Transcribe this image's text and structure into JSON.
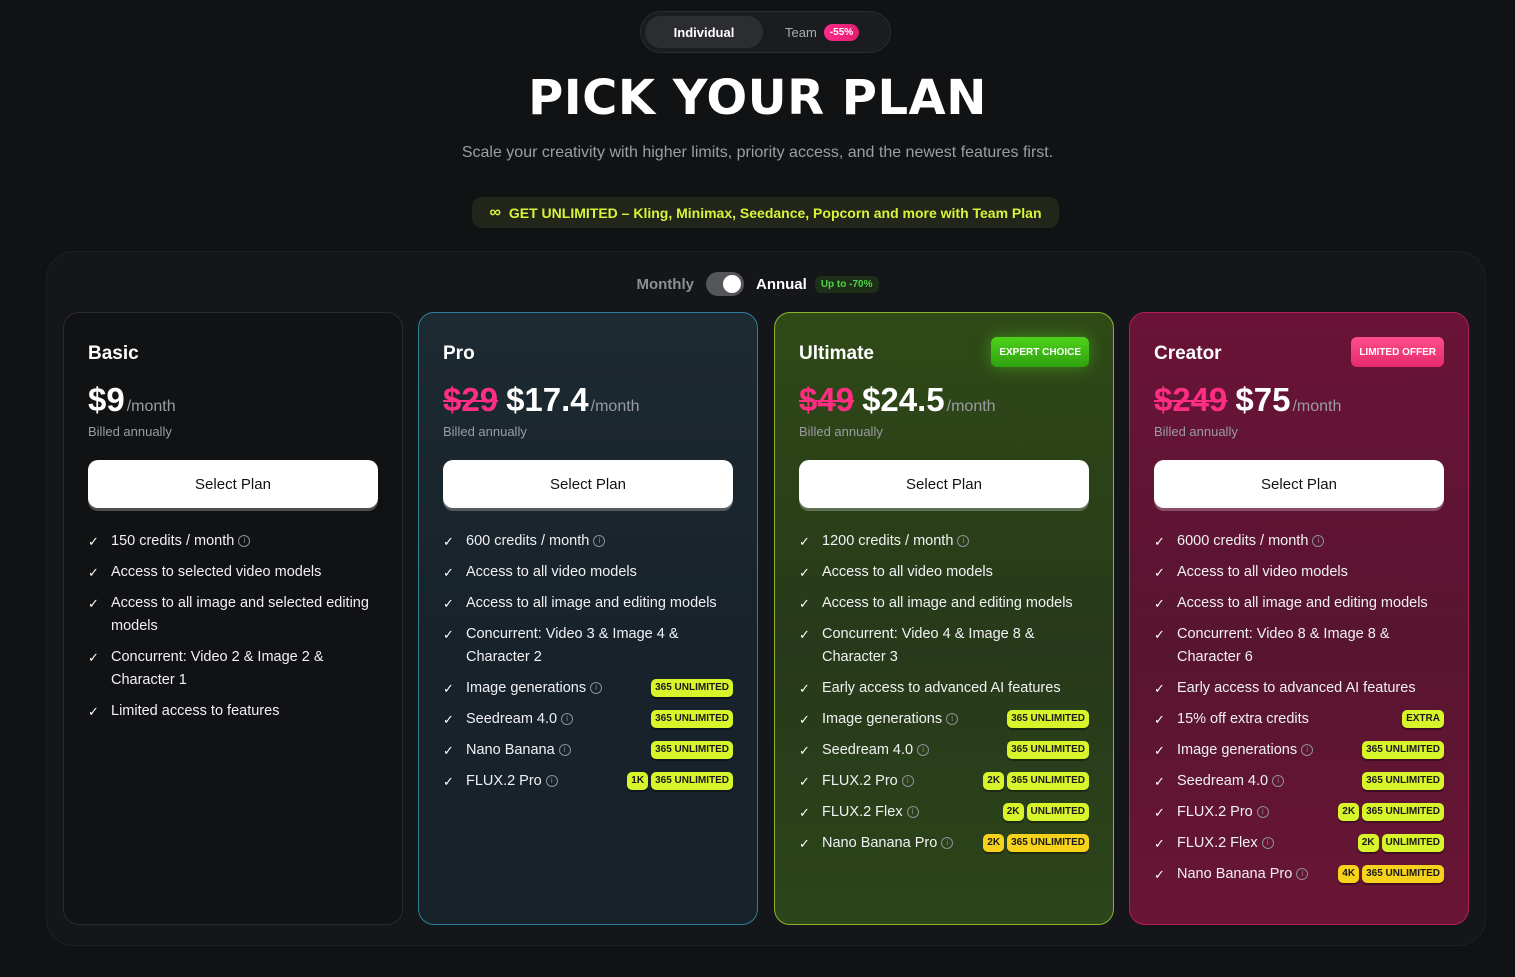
{
  "seg": {
    "individual": "Individual",
    "team": "Team",
    "team_badge": "-55%"
  },
  "title": "PICK YOUR PLAN",
  "subtitle": "Scale your creativity with higher limits, priority access, and the newest features first.",
  "promo": {
    "icon": "∞",
    "text": "GET UNLIMITED – Kling, Minimax, Seedance, Popcorn and more with Team Plan"
  },
  "billing": {
    "monthly": "Monthly",
    "annual": "Annual",
    "badge": "Up to -70%",
    "annual_selected": true
  },
  "colors": {
    "accent_lime": "#d7f52a",
    "accent_pink": "#ff2e83",
    "expert_green": "#3ec11a"
  },
  "cards": [
    {
      "name": "Basic",
      "price_old": "",
      "price": "$9",
      "per": "/month",
      "billed": "Billed annually",
      "button": "Select Plan",
      "features": [
        {
          "text": "150 credits / month",
          "info": true,
          "tags": []
        },
        {
          "text": "Access to selected video models",
          "info": false,
          "tags": []
        },
        {
          "text": "Access to all image and selected editing models",
          "info": false,
          "tags": []
        },
        {
          "text": "Concurrent: Video 2 & Image 2 & Character 1",
          "info": false,
          "tags": []
        },
        {
          "text": "Limited access to features",
          "info": false,
          "tags": []
        }
      ]
    },
    {
      "name": "Pro",
      "price_old": "$29",
      "price": "$17.4",
      "per": "/month",
      "billed": "Billed annually",
      "button": "Select Plan",
      "features": [
        {
          "text": "600 credits / month",
          "info": true,
          "tags": []
        },
        {
          "text": "Access to all video models",
          "info": false,
          "tags": []
        },
        {
          "text": "Access to all image and editing models",
          "info": false,
          "tags": []
        },
        {
          "text": "Concurrent: Video 3 & Image 4 & Character 2",
          "info": false,
          "tags": []
        },
        {
          "text": "Image generations",
          "info": true,
          "tags": [
            "365 UNLIMITED"
          ]
        },
        {
          "text": "Seedream 4.0",
          "info": true,
          "tags": [
            "365 UNLIMITED"
          ]
        },
        {
          "text": "Nano Banana",
          "info": true,
          "tags": [
            "365 UNLIMITED"
          ]
        },
        {
          "text": "FLUX.2 Pro",
          "info": true,
          "tags": [
            "1K",
            "365 UNLIMITED"
          ]
        }
      ]
    },
    {
      "name": "Ultimate",
      "ribbon": "EXPERT CHOICE",
      "price_old": "$49",
      "price": "$24.5",
      "per": "/month",
      "billed": "Billed annually",
      "button": "Select Plan",
      "features": [
        {
          "text": "1200 credits / month",
          "info": true,
          "tags": []
        },
        {
          "text": "Access to all video models",
          "info": false,
          "tags": []
        },
        {
          "text": "Access to all image and editing models",
          "info": false,
          "tags": []
        },
        {
          "text": "Concurrent: Video 4 & Image 8 & Character 3",
          "info": false,
          "tags": []
        },
        {
          "text": "Early access to advanced AI features",
          "info": false,
          "tags": []
        },
        {
          "text": "Image generations",
          "info": true,
          "tags": [
            "365 UNLIMITED"
          ]
        },
        {
          "text": "Seedream 4.0",
          "info": true,
          "tags": [
            "365 UNLIMITED"
          ]
        },
        {
          "text": "FLUX.2 Pro",
          "info": true,
          "tags": [
            "2K",
            "365 UNLIMITED"
          ]
        },
        {
          "text": "FLUX.2 Flex",
          "info": true,
          "tags": [
            "2K",
            "UNLIMITED"
          ]
        },
        {
          "text": "Nano Banana Pro",
          "info": true,
          "tags": [
            "2K*",
            "365 UNLIMITED*"
          ]
        }
      ]
    },
    {
      "name": "Creator",
      "ribbon": "LIMITED OFFER",
      "price_old": "$249",
      "price": "$75",
      "per": "/month",
      "billed": "Billed annually",
      "button": "Select Plan",
      "features": [
        {
          "text": "6000 credits / month",
          "info": true,
          "tags": []
        },
        {
          "text": "Access to all video models",
          "info": false,
          "tags": []
        },
        {
          "text": "Access to all image and editing models",
          "info": false,
          "tags": []
        },
        {
          "text": "Concurrent: Video 8 & Image 8 & Character 6",
          "info": false,
          "tags": []
        },
        {
          "text": "Early access to advanced AI features",
          "info": false,
          "tags": []
        },
        {
          "text": "15% off extra credits",
          "info": false,
          "tags": [
            "EXTRA"
          ]
        },
        {
          "text": "Image generations",
          "info": true,
          "tags": [
            "365 UNLIMITED"
          ]
        },
        {
          "text": "Seedream 4.0",
          "info": true,
          "tags": [
            "365 UNLIMITED"
          ]
        },
        {
          "text": "FLUX.2 Pro",
          "info": true,
          "tags": [
            "2K",
            "365 UNLIMITED"
          ]
        },
        {
          "text": "FLUX.2 Flex",
          "info": true,
          "tags": [
            "2K",
            "UNLIMITED"
          ]
        },
        {
          "text": "Nano Banana Pro",
          "info": true,
          "tags": [
            "4K*",
            "365 UNLIMITED*"
          ]
        }
      ]
    }
  ]
}
